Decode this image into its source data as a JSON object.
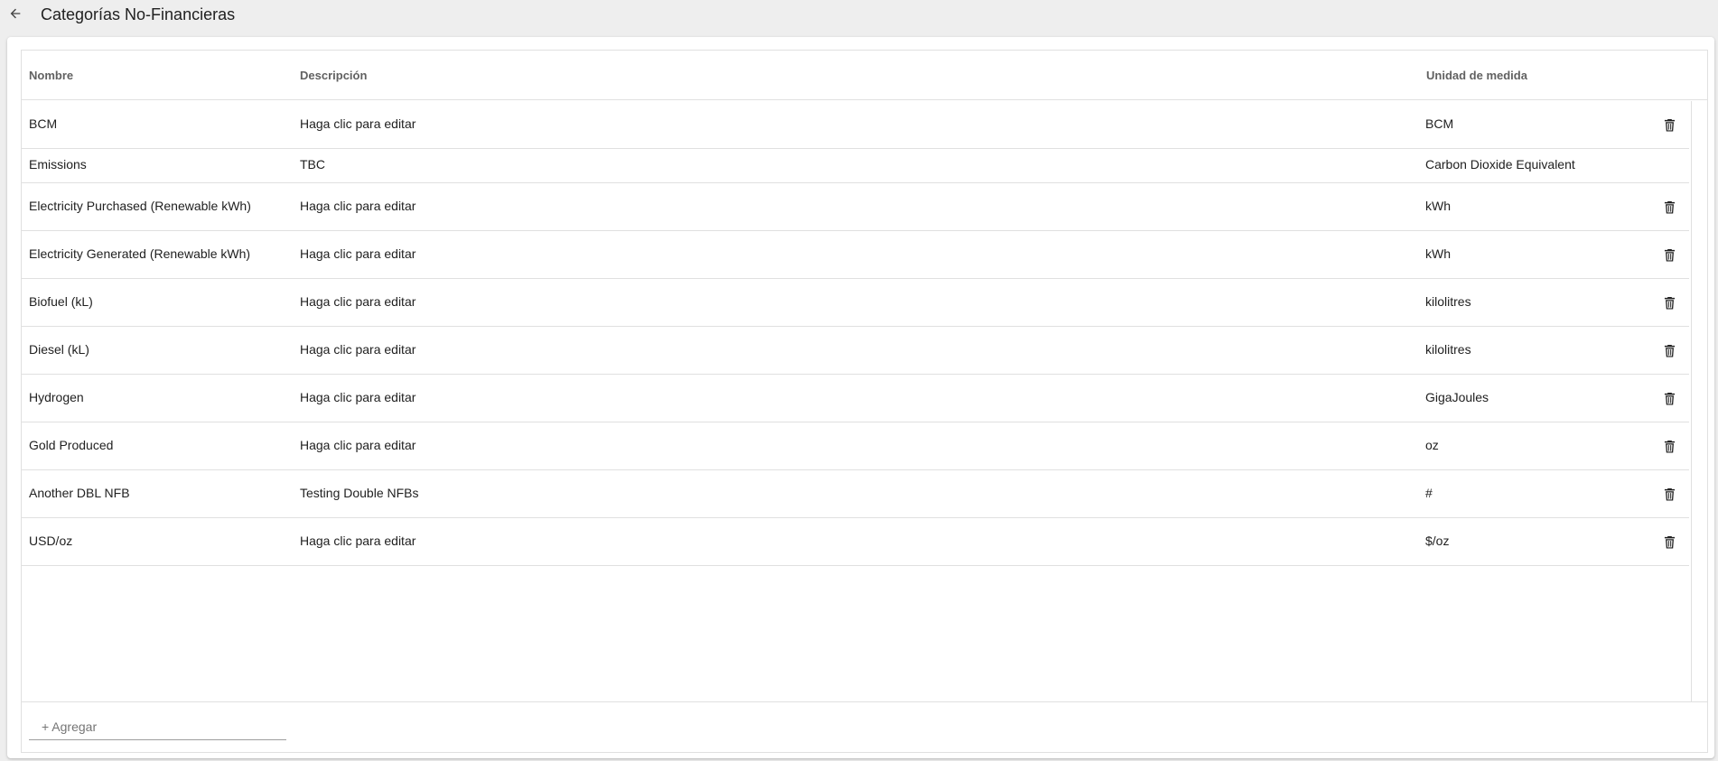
{
  "header": {
    "title": "Categorías No-Financieras",
    "back_icon": "arrow-left-icon"
  },
  "table": {
    "columns": {
      "name": "Nombre",
      "description": "Descripción",
      "unit": "Unidad de medida"
    },
    "rows": [
      {
        "name": "BCM",
        "description": "Haga clic para editar",
        "unit": "BCM",
        "deletable": true
      },
      {
        "name": "Emissions",
        "description": "TBC",
        "unit": "Carbon Dioxide Equivalent",
        "deletable": false
      },
      {
        "name": "Electricity Purchased (Renewable kWh)",
        "description": "Haga clic para editar",
        "unit": "kWh",
        "deletable": true
      },
      {
        "name": "Electricity Generated (Renewable kWh)",
        "description": "Haga clic para editar",
        "unit": "kWh",
        "deletable": true
      },
      {
        "name": "Biofuel (kL)",
        "description": "Haga clic para editar",
        "unit": "kilolitres",
        "deletable": true
      },
      {
        "name": "Diesel (kL)",
        "description": "Haga clic para editar",
        "unit": "kilolitres",
        "deletable": true
      },
      {
        "name": "Hydrogen",
        "description": "Haga clic para editar",
        "unit": "GigaJoules",
        "deletable": true
      },
      {
        "name": "Gold Produced",
        "description": "Haga clic para editar",
        "unit": "oz",
        "deletable": true
      },
      {
        "name": "Another DBL NFB",
        "description": "Testing Double NFBs",
        "unit": "#",
        "deletable": true
      },
      {
        "name": "USD/oz",
        "description": "Haga clic para editar",
        "unit": "$/oz",
        "deletable": true
      }
    ],
    "delete_icon": "trash-icon"
  },
  "footer": {
    "add_label": "+ Agregar"
  },
  "colors": {
    "background": "#eeeeee",
    "card": "#ffffff",
    "border": "#e0e0e0",
    "header_text": "#616161"
  }
}
